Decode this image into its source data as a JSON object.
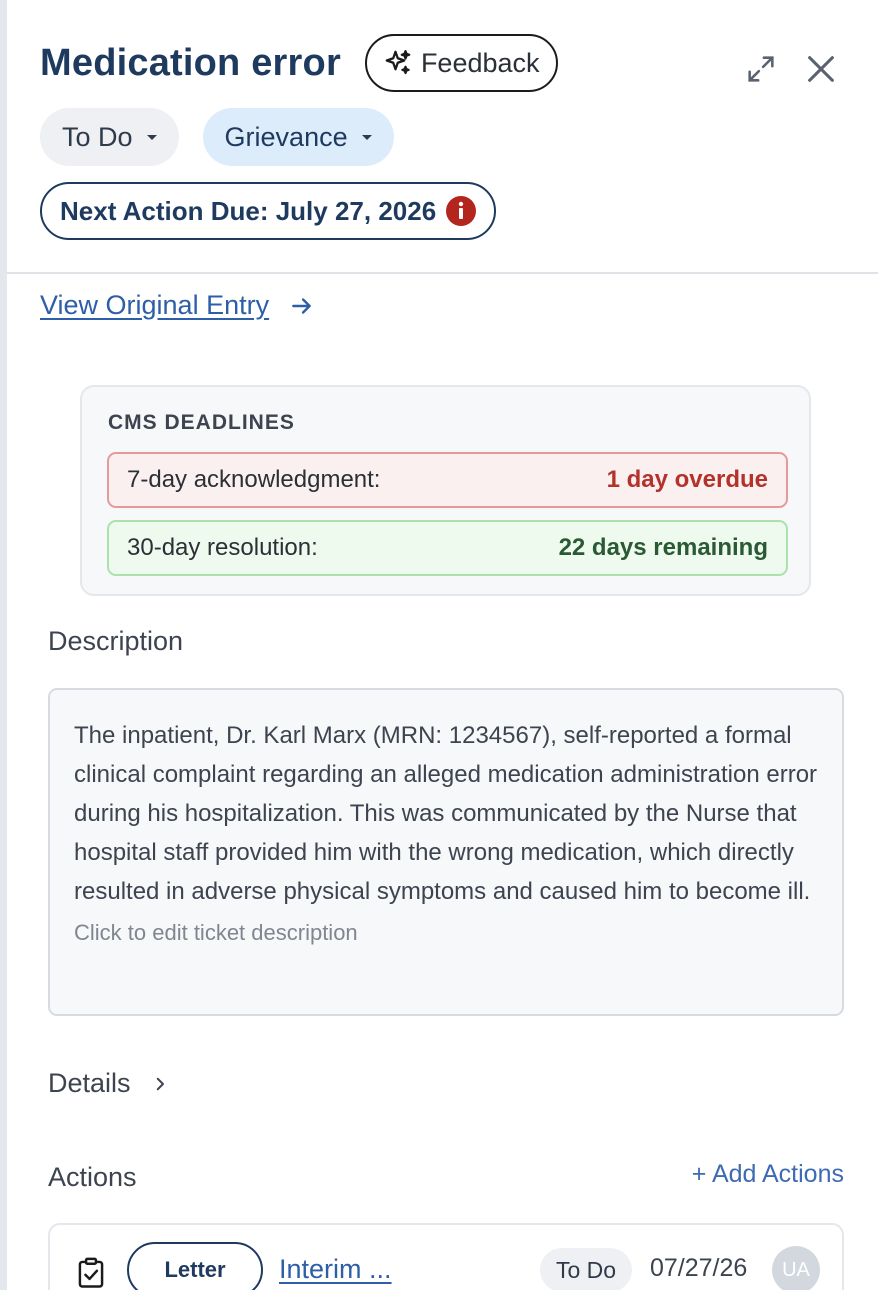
{
  "header": {
    "title": "Medication error",
    "feedback_label": "Feedback",
    "expand_icon": "expand-icon",
    "close_icon": "close-icon"
  },
  "pills": {
    "status": "To Do",
    "type": "Grievance"
  },
  "due": {
    "label": "Next Action Due: July 27, 2026",
    "icon": "info-icon",
    "icon_color": "#b3261e"
  },
  "view_original": {
    "label": "View Original Entry",
    "icon": "arrow-right-icon"
  },
  "cms": {
    "title": "CMS DEADLINES",
    "items": [
      {
        "label": "7-day acknowledgment:",
        "value": "1 day overdue",
        "status": "overdue",
        "color": "#b3322b"
      },
      {
        "label": "30-day resolution:",
        "value": "22 days remaining",
        "status": "ok",
        "color": "#2a5a34"
      }
    ]
  },
  "description": {
    "title": "Description",
    "text": "The inpatient, Dr. Karl Marx (MRN: 1234567), self-reported a formal clinical complaint regarding an alleged medication administration error during his hospitalization. This was communicated by the Nurse that hospital staff provided him with the wrong medication, which directly resulted in adverse physical symptoms and caused him to become ill.",
    "hint": "Click to edit ticket description"
  },
  "details": {
    "title": "Details",
    "icon": "chevron-right-icon"
  },
  "actions": {
    "title": "Actions",
    "add_label": "+ Add Actions",
    "items": [
      {
        "type": "Letter",
        "name": "Interim ...",
        "status": "To Do",
        "date": "07/27/26",
        "assignee": "UA",
        "icon": "clipboard-check-icon"
      }
    ]
  },
  "colors": {
    "primary": "#1f3a5f",
    "link": "#2d5ea8",
    "danger": "#b3261e"
  }
}
